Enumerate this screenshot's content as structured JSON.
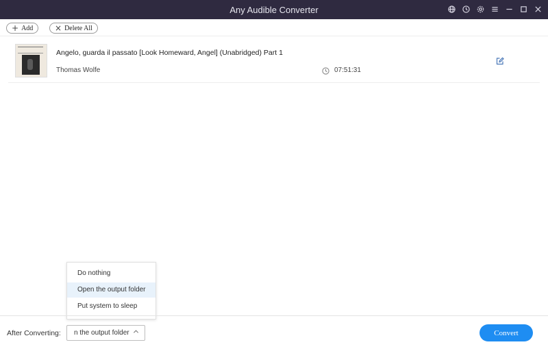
{
  "window": {
    "title": "Any Audible Converter",
    "controls": [
      "globe-icon",
      "history-icon",
      "settings-icon",
      "menu-icon",
      "minimize-icon",
      "maximize-icon",
      "close-icon"
    ]
  },
  "toolbar": {
    "add_label": "Add",
    "delete_all_label": "Delete All"
  },
  "books": [
    {
      "title": "Angelo, guarda il passato [Look Homeward, Angel] (Unabridged) Part 1",
      "author": "Thomas Wolfe",
      "duration": "07:51:31"
    }
  ],
  "footer": {
    "after_converting_label": "After Converting:",
    "selected_option": "n the output folder",
    "convert_label": "Convert"
  },
  "dropdown": {
    "options": [
      "Do nothing",
      "Open the output folder",
      "Put system to sleep"
    ],
    "highlighted_index": 1
  },
  "colors": {
    "titlebar": "#2f2a40",
    "accent": "#1e8df2",
    "highlight": "#e8f2fb"
  }
}
